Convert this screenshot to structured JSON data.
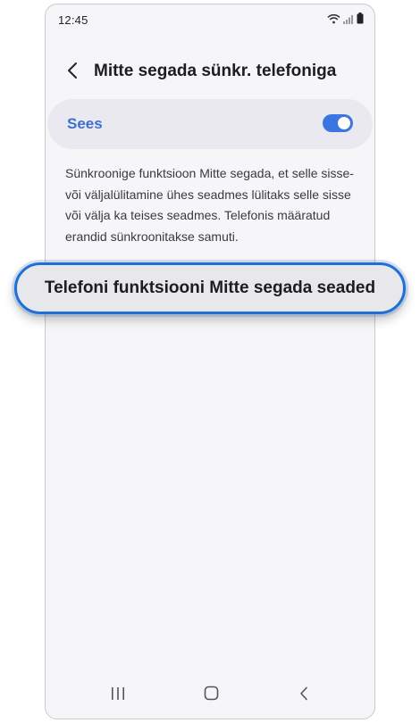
{
  "status_bar": {
    "time": "12:45",
    "icons": [
      "wifi-icon",
      "signal-icon",
      "battery-icon"
    ]
  },
  "header": {
    "title": "Mitte segada sünkr. telefoniga",
    "back_icon": "chevron-left-icon"
  },
  "master_switch": {
    "label": "Sees",
    "state": "on",
    "accent_color": "#3a75e0"
  },
  "description": "Sünkroonige funktsioon Mitte segada, et selle sisse- või väljalülitamine ühes seadmes lülitaks selle sisse või välja ka teises seadmes. Telefonis määratud erandid sünkroonitakse samuti.",
  "highlight_button": {
    "label": "Telefoni funktsiooni Mitte segada seaded",
    "border_color": "#1f6fd6"
  },
  "nav_bar": {
    "icons": [
      "recent-apps-icon",
      "home-icon",
      "back-icon"
    ]
  }
}
